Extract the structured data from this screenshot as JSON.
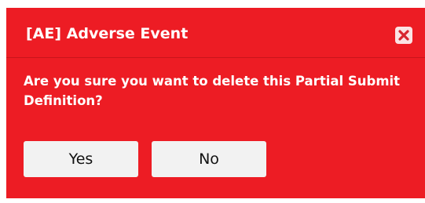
{
  "dialog": {
    "title": "[AE] Adverse Event",
    "message": "Are you sure you want to delete this Partial Submit Definition?",
    "close_icon": "close-icon",
    "buttons": {
      "yes_label": "Yes",
      "no_label": "No"
    }
  },
  "colors": {
    "dialog_background": "#ed1c24",
    "close_button_background": "#fbe3e4",
    "close_icon": "#d7262f",
    "button_background": "#f2f2f2",
    "text": "#ffffff"
  }
}
